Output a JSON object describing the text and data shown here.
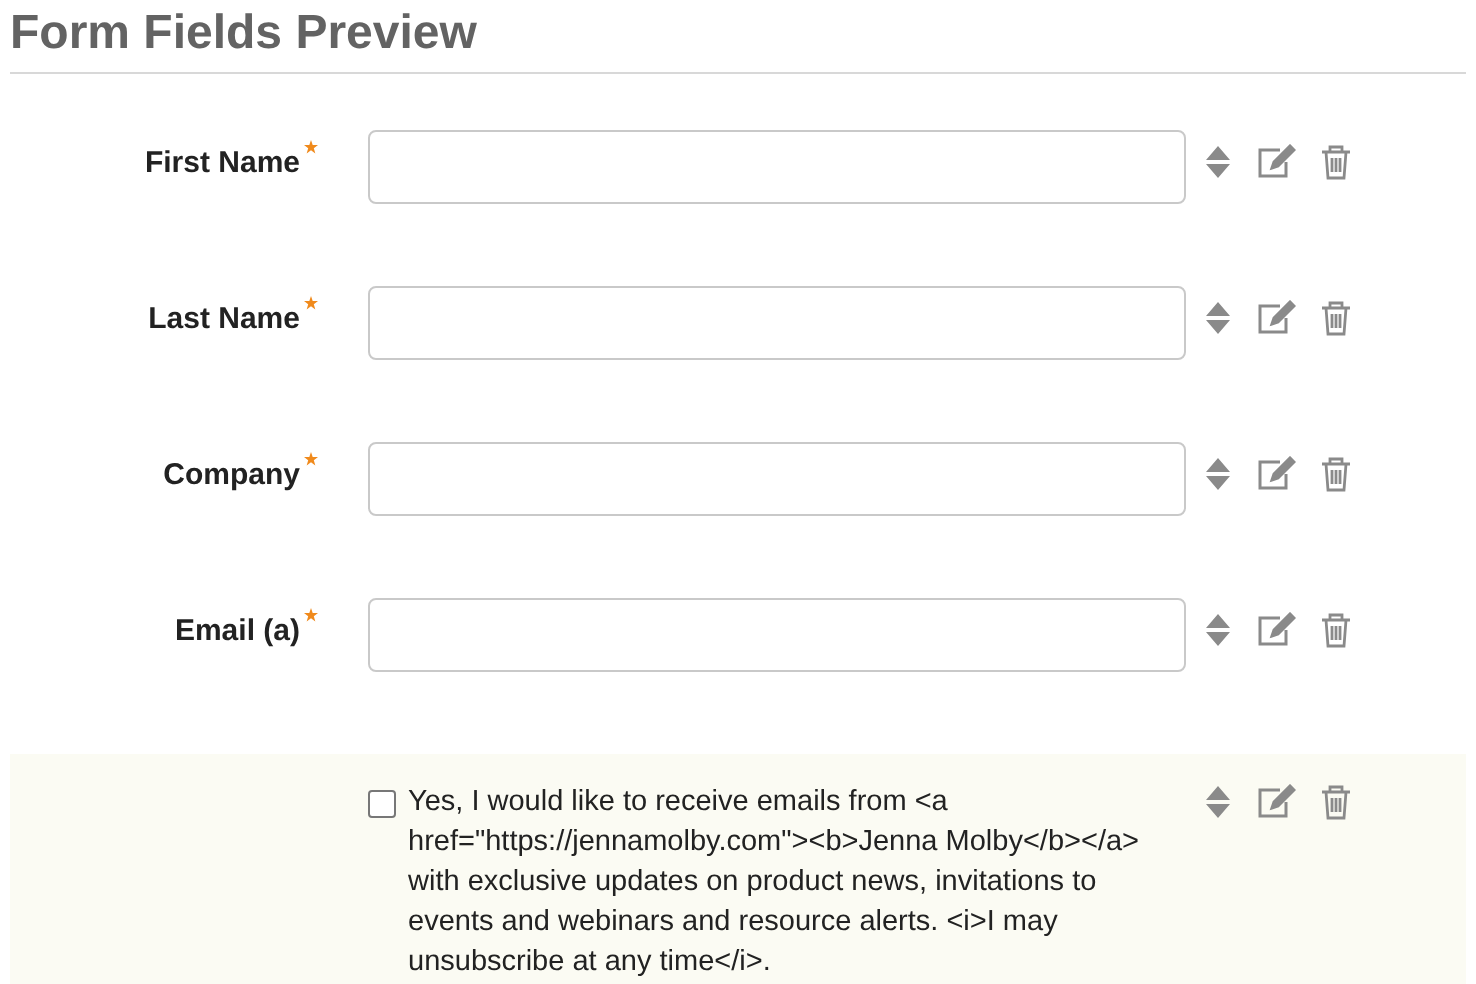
{
  "title": "Form Fields Preview",
  "fields": [
    {
      "kind": "text",
      "label": "First Name",
      "required": true
    },
    {
      "kind": "text",
      "label": "Last Name",
      "required": true
    },
    {
      "kind": "text",
      "label": "Company",
      "required": true
    },
    {
      "kind": "text",
      "label": "Email (a)",
      "required": true
    },
    {
      "kind": "checkbox",
      "label": "Yes, I would like to receive emails from <a href=\"https://jennamolby.com\"><b>Jenna Molby</b></a> with exclusive updates on product news, invitations to events and webinars and resource alerts. <i>I may unsubscribe at any time</i>.",
      "checked": false
    }
  ]
}
